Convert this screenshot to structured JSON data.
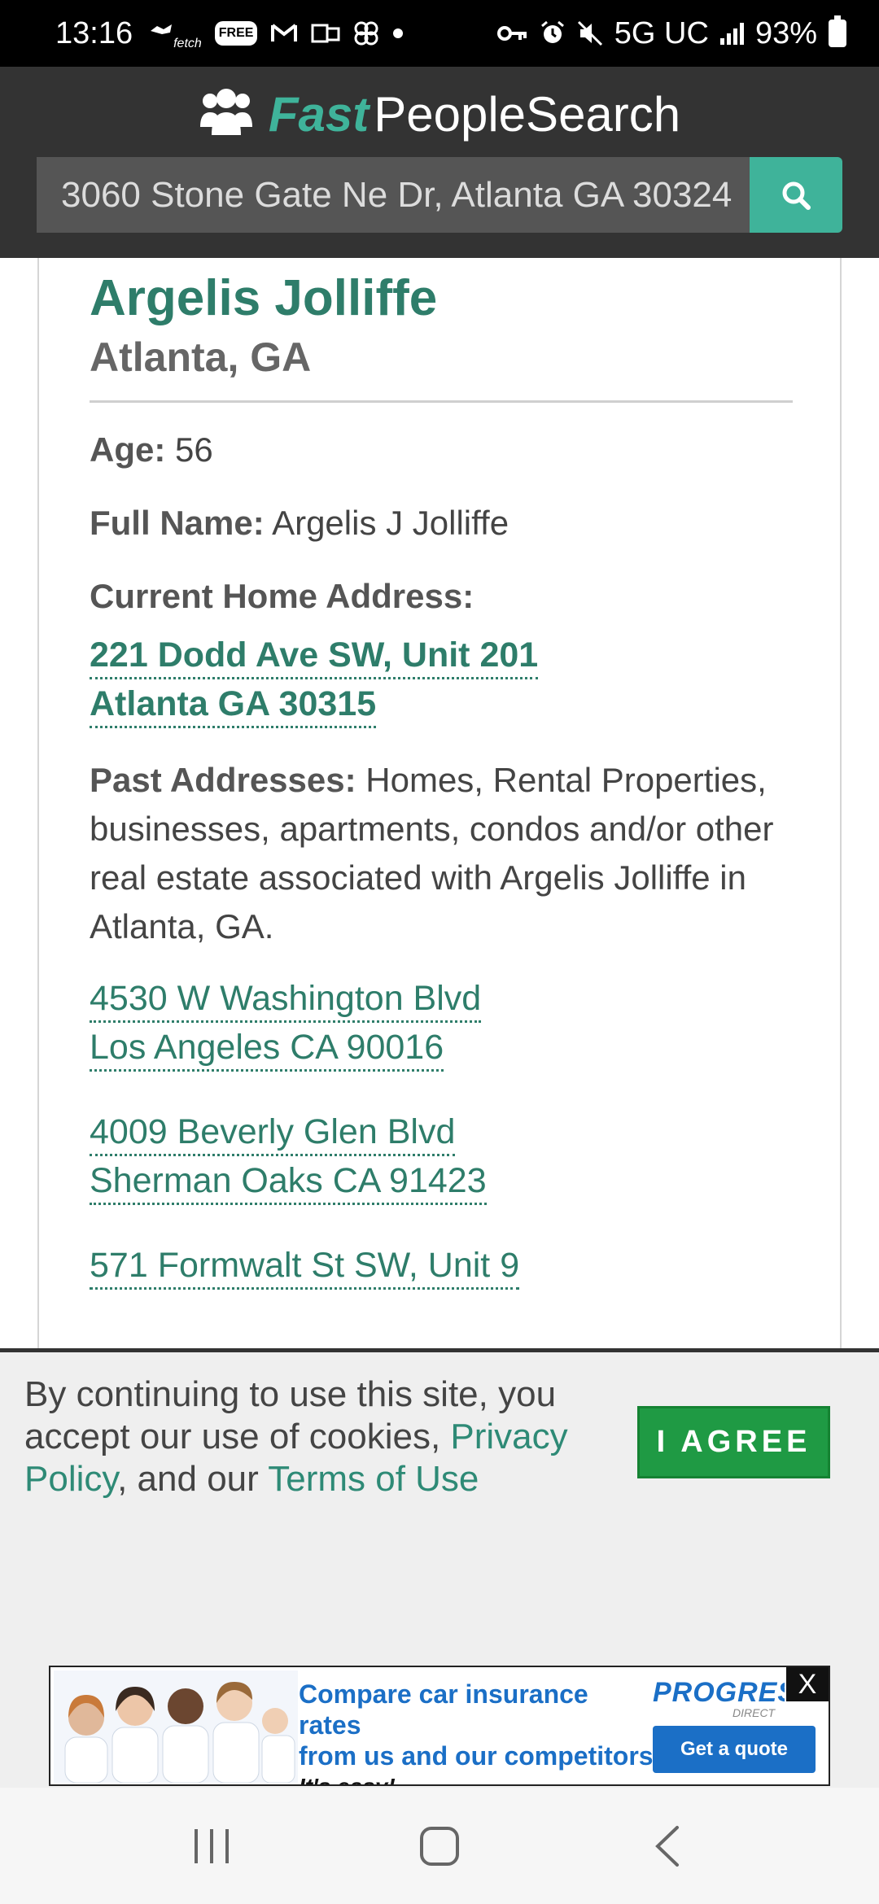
{
  "status_bar": {
    "time": "13:16",
    "fetch_label": "fetch",
    "free_badge": "FREE",
    "network": "5G UC",
    "battery": "93%"
  },
  "header": {
    "brand_fast": "Fast",
    "brand_rest": "PeopleSearch",
    "search": {
      "value": "3060 Stone Gate Ne Dr, Atlanta GA 30324"
    }
  },
  "person": {
    "name": "Argelis Jolliffe",
    "location": "Atlanta, GA",
    "age_label": "Age:",
    "age": "56",
    "fullname_label": "Full Name:",
    "fullname": "Argelis J Jolliffe",
    "current_label": "Current Home Address:",
    "current_address": {
      "line1": "221 Dodd Ave SW, Unit 201",
      "line2": "Atlanta GA 30315"
    },
    "past_label": "Past Addresses:",
    "past_desc": "Homes, Rental Properties, businesses, apartments, condos and/or other real estate associated with Argelis Jolliffe in Atlanta, GA.",
    "past_addresses": [
      {
        "line1": "4530 W Washington Blvd",
        "line2": "Los Angeles CA 90016"
      },
      {
        "line1": "4009 Beverly Glen Blvd",
        "line2": "Sherman Oaks CA 91423"
      },
      {
        "line1": "571 Formwalt St SW, Unit 9",
        "line2": ""
      }
    ]
  },
  "cookie": {
    "text_before": "By continuing to use this site, you accept our use of cookies, ",
    "privacy_link": "Privacy Policy",
    "text_middle": ", and our ",
    "terms_link": "Terms of Use",
    "agree_label": "I AGREE"
  },
  "ad": {
    "headline1": "Compare car insurance rates",
    "headline2": "from us and our competitors",
    "tagline": "It's easy!",
    "brand": "PROGRESSIVE",
    "brand_sub": "DIRECT",
    "cta": "Get a quote",
    "close": "X"
  }
}
